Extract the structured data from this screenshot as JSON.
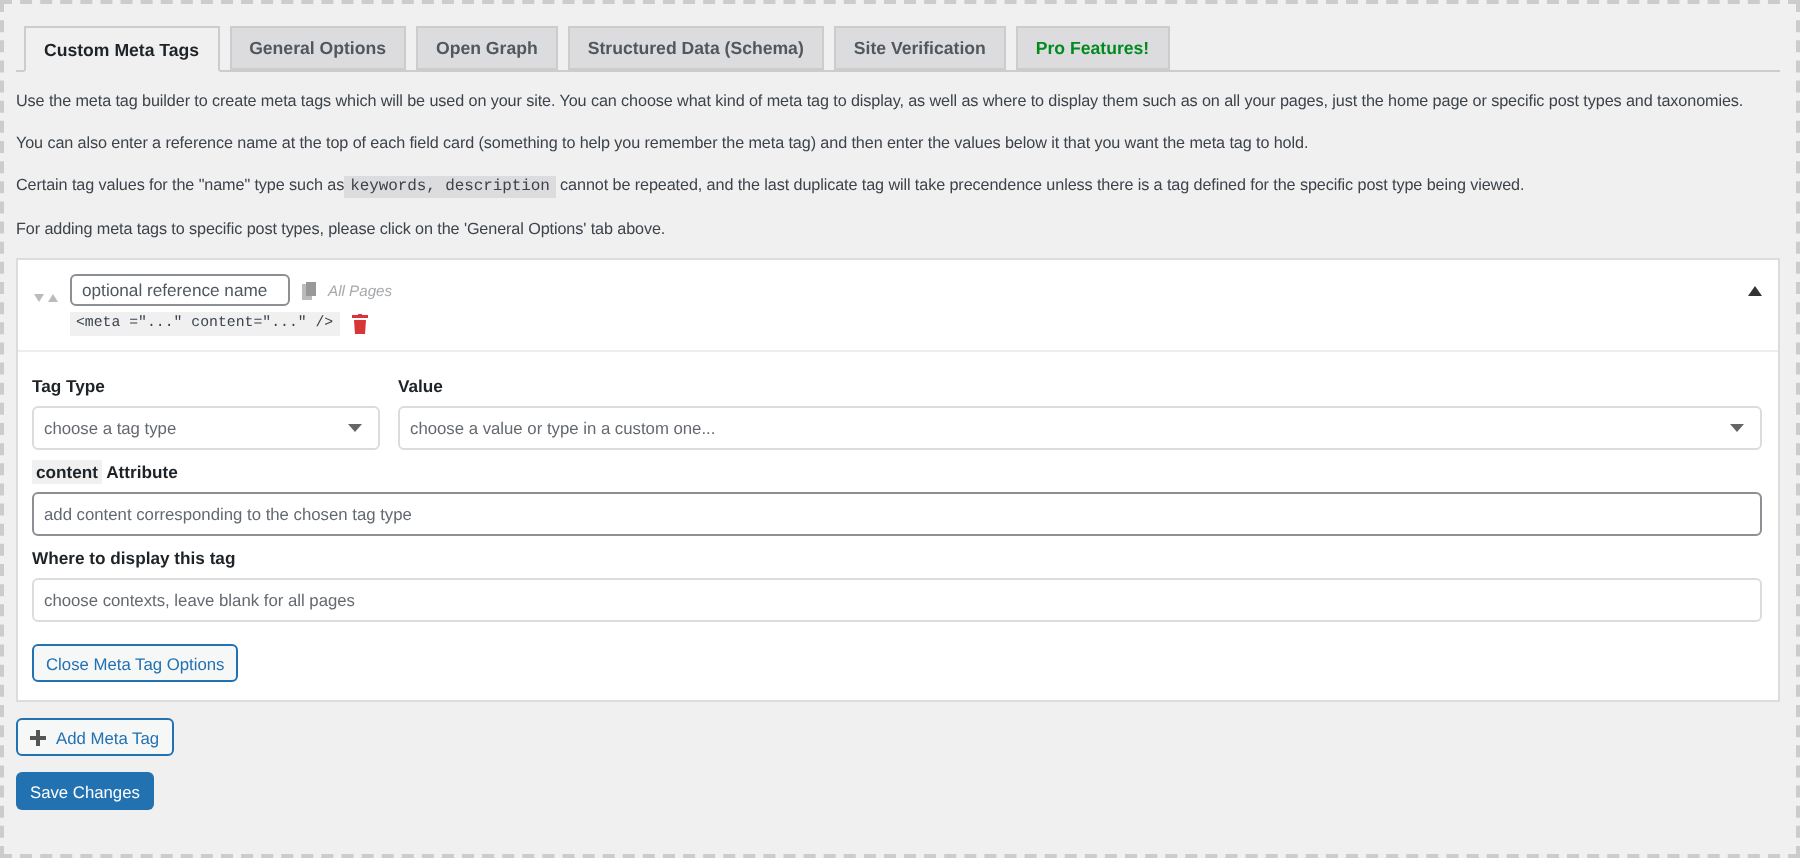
{
  "tabs": [
    {
      "label": "Custom Meta Tags",
      "selected": true,
      "kind": "normal"
    },
    {
      "label": "General Options",
      "selected": false,
      "kind": "normal"
    },
    {
      "label": "Open Graph",
      "selected": false,
      "kind": "normal"
    },
    {
      "label": "Structured Data (Schema)",
      "selected": false,
      "kind": "normal"
    },
    {
      "label": "Site Verification",
      "selected": false,
      "kind": "normal"
    },
    {
      "label": "Pro Features!",
      "selected": false,
      "kind": "pro"
    }
  ],
  "intro": [
    {
      "before": "Use the meta tag builder to create meta tags which will be used on your site. You can choose what kind of meta tag to display, as well as where to display them such as on all your pages, just the home page or specific post types and taxonomies."
    },
    {
      "before": "You can also enter a reference name at the top of each field card (something to help you remember the meta tag) and then enter the values below it that you want the meta tag to hold."
    },
    {
      "before": "Certain tag values for the \"name\" type such as",
      "code": "keywords, description",
      "after": "cannot be repeated, and the last duplicate tag will take precendence unless there is a tag defined for the specific post type being viewed."
    },
    {
      "before": "For adding meta tags to specific post types, please click on the 'General Options' tab above."
    }
  ],
  "card": {
    "expanded": true,
    "reference_placeholder": "optional reference name",
    "scope": "All Pages",
    "preview": "<meta =\"...\" content=\"...\" />",
    "tag_type": {
      "label": "Tag Type",
      "placeholder": "choose a tag type"
    },
    "value": {
      "label": "Value",
      "placeholder": "choose a value or type in a custom one..."
    },
    "content": {
      "label_code": "content",
      "label": "Attribute",
      "placeholder": "add content corresponding to the chosen tag type"
    },
    "display": {
      "label": "Where to display this tag",
      "placeholder": "choose contexts, leave blank for all pages"
    },
    "close_button": "Close Meta Tag Options"
  },
  "add_button": "Add Meta Tag",
  "save_button": "Save Changes"
}
